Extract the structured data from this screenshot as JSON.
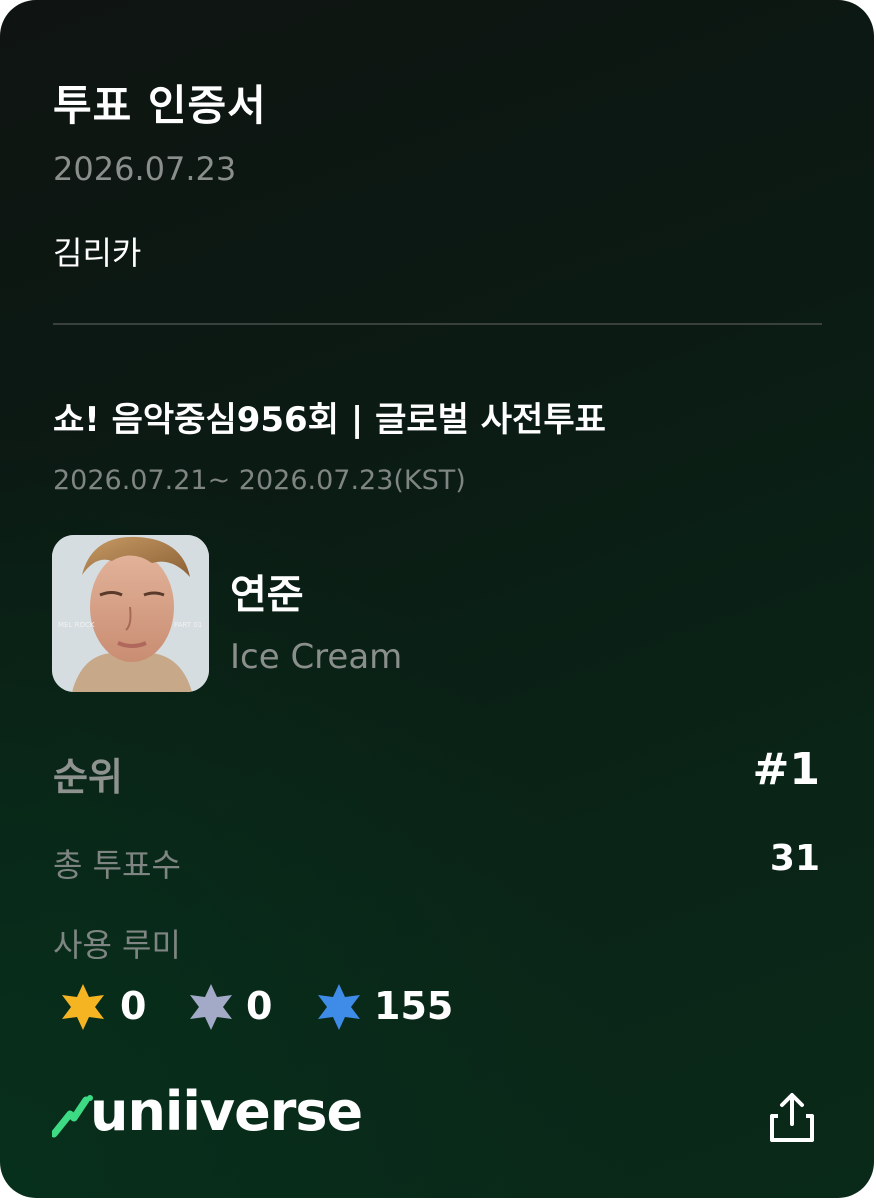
{
  "certificate": {
    "title": "투표 인증서",
    "date": "2026.07.23",
    "user_name": "김리카"
  },
  "event": {
    "title": "쇼! 음악중심956회 | 글로벌 사전투표",
    "period": "2026.07.21~ 2026.07.23(KST)"
  },
  "candidate": {
    "artist": "연준",
    "song": "Ice Cream",
    "album_art_text_left": "MEL ROCK",
    "album_art_text_right": "PART 01"
  },
  "stats": {
    "rank_label": "순위",
    "rank_value": "#1",
    "votes_label": "총 투표수",
    "votes_value": "31",
    "rumi_label": "사용 루미",
    "rumi": [
      {
        "icon": "gold-rumi-icon",
        "color": "#f5b522",
        "count": "0"
      },
      {
        "icon": "silver-rumi-icon",
        "color": "#a3aac8",
        "count": "0"
      },
      {
        "icon": "blue-rumi-icon",
        "color": "#3f8be8",
        "count": "155"
      }
    ]
  },
  "brand": {
    "logo_text": "uniiverse",
    "accent_color": "#3ddc84"
  },
  "actions": {
    "share_icon": "share-icon"
  }
}
